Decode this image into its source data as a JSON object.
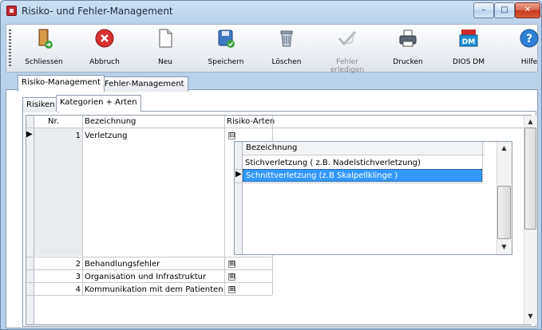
{
  "window": {
    "title": "Risiko- und Fehler-Management",
    "min": "–",
    "max": "□",
    "close": "✕"
  },
  "toolbar": {
    "buttons": [
      {
        "label": "Schliessen",
        "icon": "door-exit-icon"
      },
      {
        "label": "Abbruch",
        "icon": "cancel-icon"
      },
      {
        "label": "Neu",
        "icon": "new-document-icon"
      },
      {
        "label": "Speichern",
        "icon": "save-icon"
      },
      {
        "label": "Löschen",
        "icon": "trash-icon"
      },
      {
        "label": "Fehler erledigen",
        "icon": "checkmark-icon",
        "disabled": true
      },
      {
        "label": "Drucken",
        "icon": "printer-icon"
      },
      {
        "label": "DIOS DM",
        "icon": "pdf-dm-icon"
      },
      {
        "label": "Hilfe",
        "icon": "help-icon"
      }
    ]
  },
  "tabs": {
    "outer": [
      "Risiko-Management",
      "Fehler-Management"
    ],
    "inner": [
      "Risiken",
      "Kategorien + Arten"
    ]
  },
  "grid": {
    "headers": {
      "nr": "Nr.",
      "bezeichnung": "Bezeichnung",
      "risiko_arten": "Risiko-Arten"
    },
    "rows": [
      {
        "nr": "1",
        "bezeichnung": "Verletzung",
        "expander": "⊟"
      },
      {
        "nr": "2",
        "bezeichnung": "Behandlungsfehler",
        "expander": "⊞"
      },
      {
        "nr": "3",
        "bezeichnung": "Organisation und Infrastruktur",
        "expander": "⊞"
      },
      {
        "nr": "4",
        "bezeichnung": "Kommunikation mit dem Patienten",
        "expander": "⊞"
      }
    ]
  },
  "nested": {
    "header": "Bezeichnung",
    "rows": [
      "Stichverletzung ( z.B. Nadelstichverletzung)",
      "Schnittverletzung (z.B Skalpellklinge )"
    ]
  },
  "colors": {
    "selection": "#3399ff",
    "window_frame": "#b9d1ea",
    "close_button": "#c6371c"
  }
}
